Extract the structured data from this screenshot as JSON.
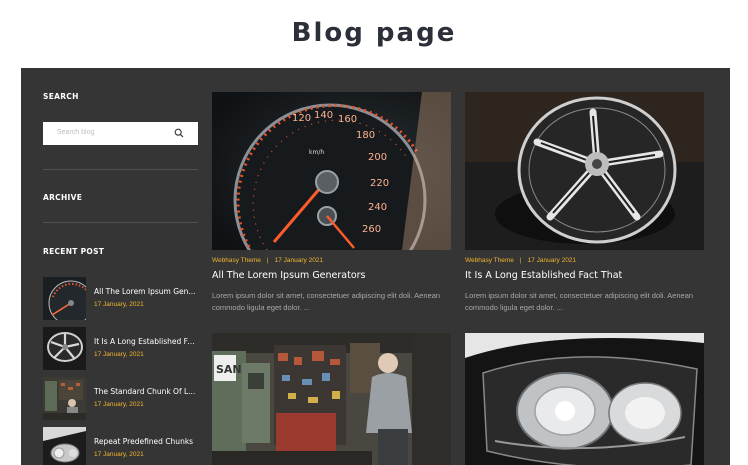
{
  "page": {
    "title": "Blog page"
  },
  "sidebar": {
    "search_heading": "SEARCH",
    "search_placeholder": "Search blog",
    "archive_heading": "ARCHIVE",
    "recent_heading": "RECENT POST",
    "recent_posts": [
      {
        "title": "All The Lorem Ipsum Gen...",
        "date": "17 January, 2021",
        "thumb": "speedometer"
      },
      {
        "title": "It Is A Long Established Fa...",
        "date": "17 January, 2021",
        "thumb": "wheel-rim"
      },
      {
        "title": "The Standard Chunk Of L...",
        "date": "17 January, 2021",
        "thumb": "workshop"
      },
      {
        "title": "Repeat Predefined Chunks",
        "date": "17 January, 2021",
        "thumb": "headlight"
      }
    ]
  },
  "posts": [
    {
      "author": "Webhasy Theme",
      "date": "17 January 2021",
      "title": "All The Lorem Ipsum Generators",
      "excerpt": "Lorem ipsum dolor sit amet, consectetuer adipiscing elit doli. Aenean commodo ligula eget dolor. ...",
      "image": "speedometer"
    },
    {
      "author": "Webhasy Theme",
      "date": "17 January 2021",
      "title": "It Is A Long Established Fact That",
      "excerpt": "Lorem ipsum dolor sit amet, consectetuer adipiscing elit doli. Aenean commodo ligula eget dolor. ...",
      "image": "wheel-rim"
    },
    {
      "image": "workshop"
    },
    {
      "image": "headlight"
    }
  ],
  "speedometer": {
    "marks": [
      "120",
      "140",
      "160",
      "180",
      "200",
      "220",
      "240",
      "260",
      "km/h"
    ]
  },
  "workshop": {
    "sign": "SAN"
  },
  "colors": {
    "panel": "#353535",
    "accent": "#f1b52d",
    "title": "#2b2f3a"
  }
}
